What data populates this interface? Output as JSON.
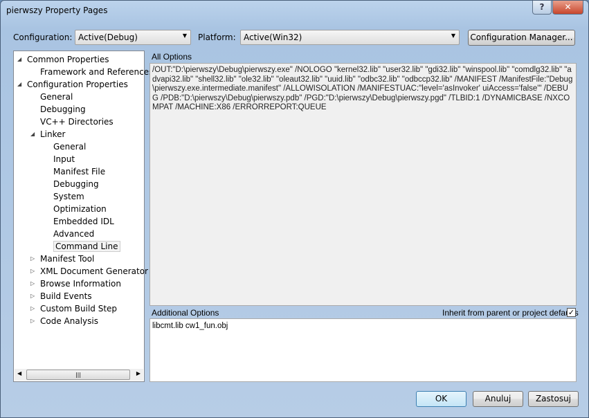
{
  "window": {
    "title": "pierwszy Property Pages"
  },
  "config": {
    "label": "Configuration:",
    "value": "Active(Debug)"
  },
  "platform": {
    "label": "Platform:",
    "value": "Active(Win32)"
  },
  "config_manager": "Configuration Manager...",
  "tree": [
    {
      "label": "Common Properties",
      "level": 0,
      "expander": "expanded"
    },
    {
      "label": "Framework and References",
      "level": 1
    },
    {
      "label": "Configuration Properties",
      "level": 0,
      "expander": "expanded"
    },
    {
      "label": "General",
      "level": 1
    },
    {
      "label": "Debugging",
      "level": 1
    },
    {
      "label": "VC++ Directories",
      "level": 1
    },
    {
      "label": "Linker",
      "level": 1,
      "expander": "expanded"
    },
    {
      "label": "General",
      "level": 2
    },
    {
      "label": "Input",
      "level": 2
    },
    {
      "label": "Manifest File",
      "level": 2
    },
    {
      "label": "Debugging",
      "level": 2
    },
    {
      "label": "System",
      "level": 2
    },
    {
      "label": "Optimization",
      "level": 2
    },
    {
      "label": "Embedded IDL",
      "level": 2
    },
    {
      "label": "Advanced",
      "level": 2
    },
    {
      "label": "Command Line",
      "level": 2,
      "selected": true
    },
    {
      "label": "Manifest Tool",
      "level": 1,
      "expander": "collapsed"
    },
    {
      "label": "XML Document Generator",
      "level": 1,
      "expander": "collapsed"
    },
    {
      "label": "Browse Information",
      "level": 1,
      "expander": "collapsed"
    },
    {
      "label": "Build Events",
      "level": 1,
      "expander": "collapsed"
    },
    {
      "label": "Custom Build Step",
      "level": 1,
      "expander": "collapsed"
    },
    {
      "label": "Code Analysis",
      "level": 1,
      "expander": "collapsed"
    }
  ],
  "all_options": {
    "label": "All Options",
    "text": "/OUT:\"D:\\pierwszy\\Debug\\pierwszy.exe\" /NOLOGO \"kernel32.lib\" \"user32.lib\" \"gdi32.lib\" \"winspool.lib\" \"comdlg32.lib\" \"advapi32.lib\" \"shell32.lib\" \"ole32.lib\" \"oleaut32.lib\" \"uuid.lib\" \"odbc32.lib\" \"odbccp32.lib\" /MANIFEST /ManifestFile:\"Debug\\pierwszy.exe.intermediate.manifest\" /ALLOWISOLATION /MANIFESTUAC:\"level='asInvoker' uiAccess='false'\" /DEBUG /PDB:\"D:\\pierwszy\\Debug\\pierwszy.pdb\" /PGD:\"D:\\pierwszy\\Debug\\pierwszy.pgd\" /TLBID:1 /DYNAMICBASE /NXCOMPAT /MACHINE:X86 /ERRORREPORT:QUEUE"
  },
  "additional": {
    "label": "Additional Options",
    "value": "libcmt.lib cw1_fun.obj",
    "inherit_label": "Inherit from parent or project defaults",
    "inherit_checked": true
  },
  "buttons": {
    "ok": "OK",
    "cancel": "Anuluj",
    "apply": "Zastosuj"
  }
}
